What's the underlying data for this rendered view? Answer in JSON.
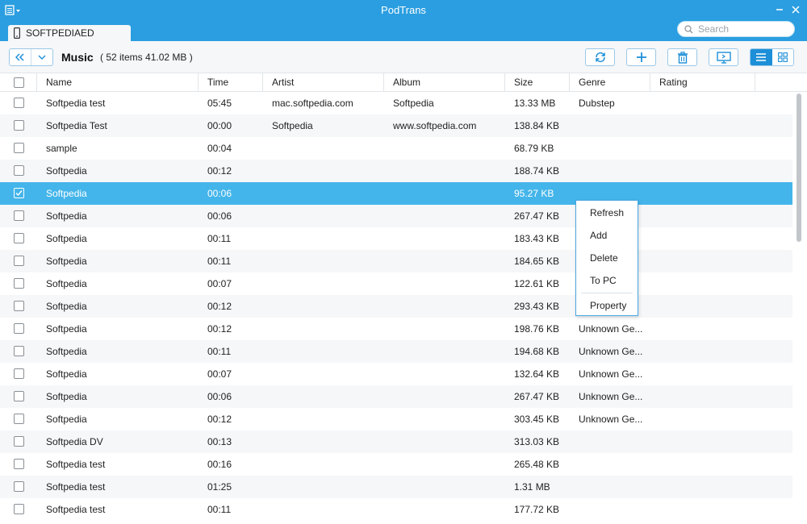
{
  "window": {
    "title": "PodTrans"
  },
  "device_tab": {
    "label": "SOFTPEDIAED"
  },
  "search": {
    "placeholder": "Search"
  },
  "toolbar": {
    "category": "Music",
    "stats": "( 52 items 41.02 MB )"
  },
  "icons": {
    "app_menu": "hamburger-menu-icon",
    "back": "double-chevron-left-icon",
    "dropdown": "chevron-down-icon",
    "refresh": "refresh-icon",
    "add": "plus-icon",
    "delete": "trash-icon",
    "to_pc": "monitor-icon",
    "list_view": "list-view-icon",
    "grid_view": "grid-view-icon",
    "device": "phone-icon",
    "search": "search-icon"
  },
  "colors": {
    "accent": "#2a9ee0",
    "selected_row": "#44b5ea",
    "alt_row": "#f5f7f9"
  },
  "table": {
    "columns": [
      "Name",
      "Time",
      "Artist",
      "Album",
      "Size",
      "Genre",
      "Rating"
    ],
    "rows": [
      {
        "checked": false,
        "name": "Softpedia test",
        "time": "05:45",
        "artist": "mac.softpedia.com",
        "album": "Softpedia",
        "size": "13.33 MB",
        "genre": "Dubstep",
        "rating": ""
      },
      {
        "checked": false,
        "name": "Softpedia Test",
        "time": "00:00",
        "artist": "Softpedia",
        "album": "www.softpedia.com",
        "size": "138.84 KB",
        "genre": "",
        "rating": ""
      },
      {
        "checked": false,
        "name": "sample",
        "time": "00:04",
        "artist": "",
        "album": "",
        "size": "68.79 KB",
        "genre": "",
        "rating": ""
      },
      {
        "checked": false,
        "name": "Softpedia",
        "time": "00:12",
        "artist": "",
        "album": "",
        "size": "188.74 KB",
        "genre": "",
        "rating": ""
      },
      {
        "checked": true,
        "name": "Softpedia",
        "time": "00:06",
        "artist": "",
        "album": "",
        "size": "95.27 KB",
        "genre": "",
        "rating": ""
      },
      {
        "checked": false,
        "name": "Softpedia",
        "time": "00:06",
        "artist": "",
        "album": "",
        "size": "267.47 KB",
        "genre": "",
        "rating": ""
      },
      {
        "checked": false,
        "name": "Softpedia",
        "time": "00:11",
        "artist": "",
        "album": "",
        "size": "183.43 KB",
        "genre": "",
        "rating": ""
      },
      {
        "checked": false,
        "name": "Softpedia",
        "time": "00:11",
        "artist": "",
        "album": "",
        "size": "184.65 KB",
        "genre": "",
        "rating": ""
      },
      {
        "checked": false,
        "name": "Softpedia",
        "time": "00:07",
        "artist": "",
        "album": "",
        "size": "122.61 KB",
        "genre": "",
        "rating": ""
      },
      {
        "checked": false,
        "name": "Softpedia",
        "time": "00:12",
        "artist": "",
        "album": "",
        "size": "293.43 KB",
        "genre": "",
        "rating": ""
      },
      {
        "checked": false,
        "name": "Softpedia",
        "time": "00:12",
        "artist": "",
        "album": "",
        "size": "198.76 KB",
        "genre": "Unknown Ge...",
        "rating": ""
      },
      {
        "checked": false,
        "name": "Softpedia",
        "time": "00:11",
        "artist": "",
        "album": "",
        "size": "194.68 KB",
        "genre": "Unknown Ge...",
        "rating": ""
      },
      {
        "checked": false,
        "name": "Softpedia",
        "time": "00:07",
        "artist": "",
        "album": "",
        "size": "132.64 KB",
        "genre": "Unknown Ge...",
        "rating": ""
      },
      {
        "checked": false,
        "name": "Softpedia",
        "time": "00:06",
        "artist": "",
        "album": "",
        "size": "267.47 KB",
        "genre": "Unknown Ge...",
        "rating": ""
      },
      {
        "checked": false,
        "name": "Softpedia",
        "time": "00:12",
        "artist": "",
        "album": "",
        "size": "303.45 KB",
        "genre": "Unknown Ge...",
        "rating": ""
      },
      {
        "checked": false,
        "name": "Softpedia DV",
        "time": "00:13",
        "artist": "",
        "album": "",
        "size": "313.03 KB",
        "genre": "",
        "rating": ""
      },
      {
        "checked": false,
        "name": "Softpedia test",
        "time": "00:16",
        "artist": "",
        "album": "",
        "size": "265.48 KB",
        "genre": "",
        "rating": ""
      },
      {
        "checked": false,
        "name": "Softpedia test",
        "time": "01:25",
        "artist": "",
        "album": "",
        "size": "1.31 MB",
        "genre": "",
        "rating": ""
      },
      {
        "checked": false,
        "name": "Softpedia test",
        "time": "00:11",
        "artist": "",
        "album": "",
        "size": "177.72 KB",
        "genre": "",
        "rating": ""
      }
    ]
  },
  "context_menu": {
    "items": [
      "Refresh",
      "Add",
      "Delete",
      "To PC",
      "Property"
    ]
  }
}
